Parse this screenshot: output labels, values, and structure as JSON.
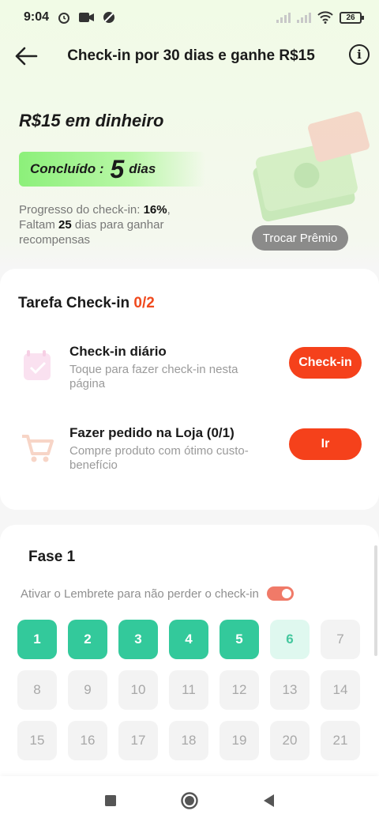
{
  "status_bar": {
    "time": "9:04",
    "battery": "26"
  },
  "header": {
    "title": "Check-in por 30 dias e ganhe R$15",
    "info_label": "i"
  },
  "hero": {
    "title": "R$15 em dinheiro",
    "completed_label": "Concluído :",
    "completed_days": "5",
    "completed_unit": "dias",
    "progress_prefix": "Progresso do check-in:",
    "progress_value": "16%",
    "progress_suffix": ",",
    "remaining_prefix": "Faltam",
    "remaining_days": "25",
    "remaining_suffix": "dias para ganhar recompensas",
    "swap_button": "Trocar Prêmio"
  },
  "tasks": {
    "heading": "Tarefa Check-in",
    "count": "0/2",
    "items": [
      {
        "title": "Check-in diário",
        "desc": "Toque para fazer check-in nesta página",
        "button": "Check-in"
      },
      {
        "title": "Fazer pedido na Loja  (0/1)",
        "desc": "Compre produto com ótimo custo-benefício",
        "button": "Ir"
      }
    ]
  },
  "phase": {
    "title": "Fase 1",
    "reminder": "Ativar o Lembrete para não perder o check-in",
    "days": [
      "1",
      "2",
      "3",
      "4",
      "5",
      "6",
      "7",
      "8",
      "9",
      "10",
      "11",
      "12",
      "13",
      "14",
      "15",
      "16",
      "17",
      "18",
      "19",
      "20",
      "21"
    ],
    "completed_through": 5,
    "today": 6
  },
  "colors": {
    "accent": "#f5411b",
    "done": "#33c99b",
    "today_bg": "#dff8ef"
  }
}
